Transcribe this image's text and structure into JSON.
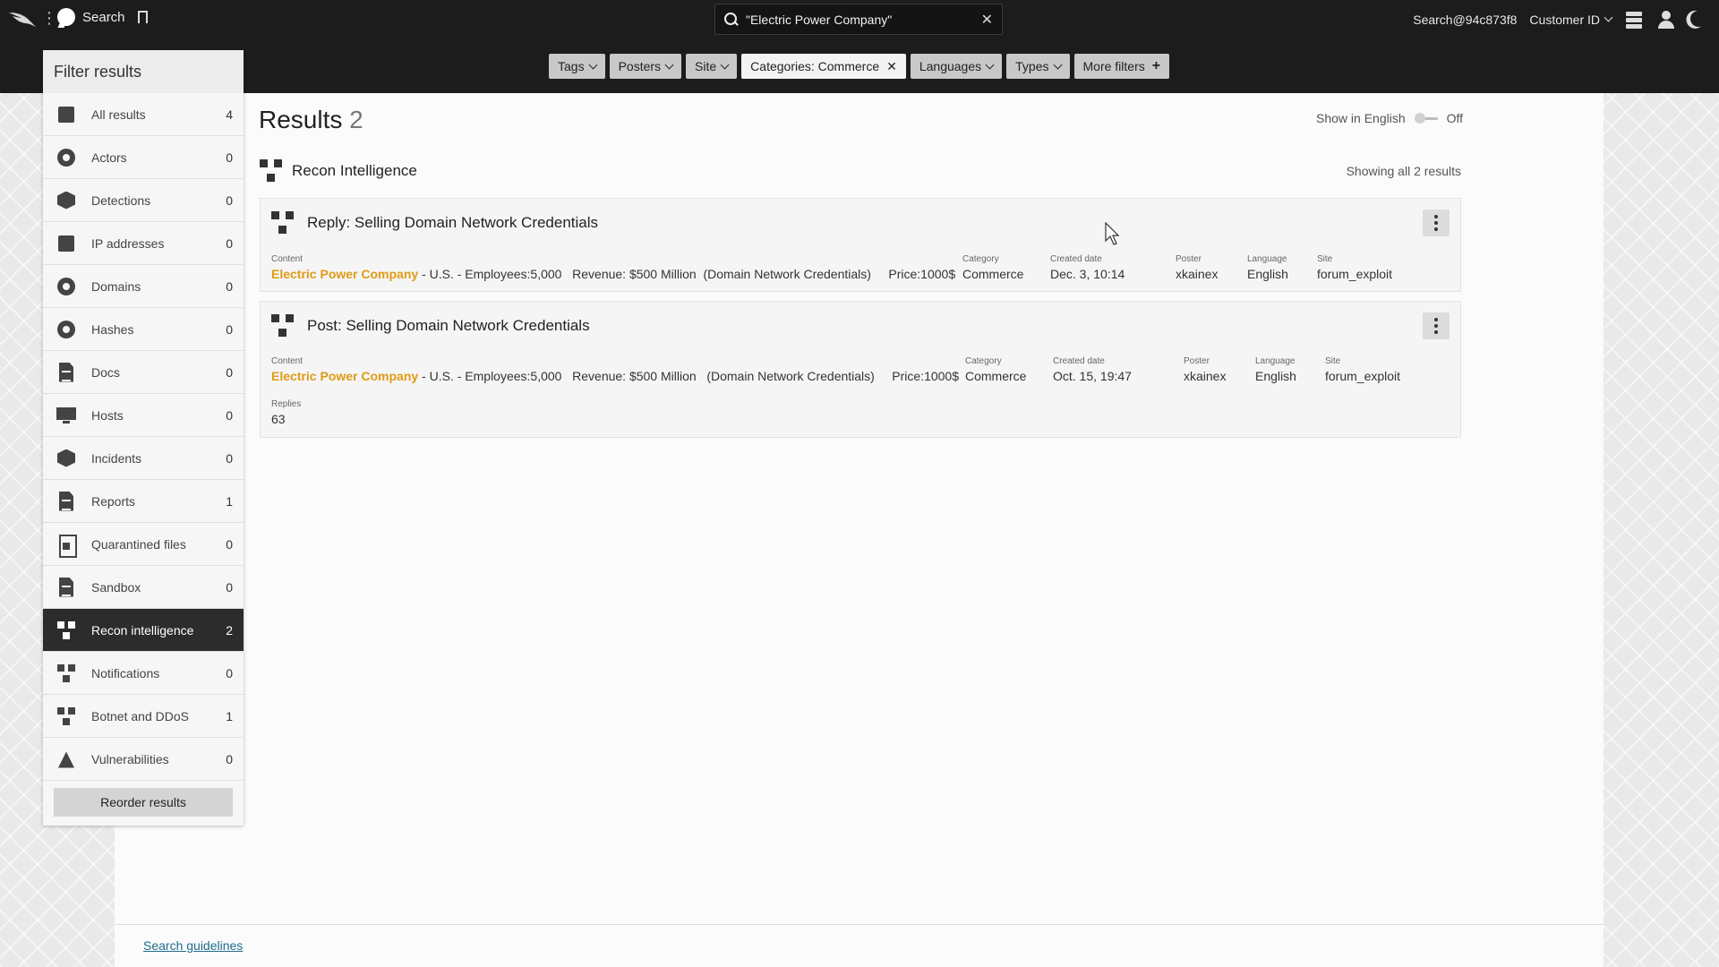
{
  "topbar": {
    "search_label": "Search",
    "search_query": "\"Electric Power Company\"",
    "account": "Search@94c873f8",
    "customer_label": "Customer ID"
  },
  "filters": [
    {
      "label": "Tags",
      "type": "dropdown"
    },
    {
      "label": "Posters",
      "type": "dropdown"
    },
    {
      "label": "Site",
      "type": "dropdown"
    },
    {
      "label": "Categories: Commerce",
      "type": "active"
    },
    {
      "label": "Languages",
      "type": "dropdown"
    },
    {
      "label": "Types",
      "type": "dropdown"
    },
    {
      "label": "More filters",
      "type": "add"
    }
  ],
  "sidebar": {
    "header": "Filter results",
    "items": [
      {
        "label": "All results",
        "count": "4",
        "icon": "all-results-icon"
      },
      {
        "label": "Actors",
        "count": "0",
        "icon": "actor-mask-icon"
      },
      {
        "label": "Detections",
        "count": "0",
        "icon": "detections-icon"
      },
      {
        "label": "IP addresses",
        "count": "0",
        "icon": "ip-address-icon"
      },
      {
        "label": "Domains",
        "count": "0",
        "icon": "globe-icon"
      },
      {
        "label": "Hashes",
        "count": "0",
        "icon": "fingerprint-icon"
      },
      {
        "label": "Docs",
        "count": "0",
        "icon": "document-icon"
      },
      {
        "label": "Hosts",
        "count": "0",
        "icon": "monitor-icon"
      },
      {
        "label": "Incidents",
        "count": "0",
        "icon": "hexagon-icon"
      },
      {
        "label": "Reports",
        "count": "1",
        "icon": "report-icon"
      },
      {
        "label": "Quarantined files",
        "count": "0",
        "icon": "locked-file-icon"
      },
      {
        "label": "Sandbox",
        "count": "0",
        "icon": "sandbox-icon"
      },
      {
        "label": "Recon intelligence",
        "count": "2",
        "icon": "recon-icon",
        "active": true
      },
      {
        "label": "Notifications",
        "count": "0",
        "icon": "recon-icon"
      },
      {
        "label": "Botnet and DDoS",
        "count": "1",
        "icon": "recon-icon"
      },
      {
        "label": "Vulnerabilities",
        "count": "0",
        "icon": "vulnerability-icon"
      }
    ],
    "reorder_label": "Reorder results"
  },
  "results": {
    "title": "Results",
    "count": "2",
    "show_english_label": "Show in English",
    "show_english_state": "Off",
    "section_title": "Recon Intelligence",
    "showing_text": "Showing all 2 results"
  },
  "cards": [
    {
      "title": "Reply: Selling Domain Network Credentials",
      "labels": {
        "content": "Content",
        "category": "Category",
        "created": "Created date",
        "poster": "Poster",
        "language": "Language",
        "site": "Site"
      },
      "content_highlight": "Electric Power Company",
      "content_rest": " - U.S. - Employees:5,000   Revenue: $500 Million  (Domain Network Credentials)     Price:1000$",
      "category": "Commerce",
      "created": "Dec. 3, 10:14",
      "poster": "xkainex",
      "language": "English",
      "site": "forum_exploit"
    },
    {
      "title": "Post: Selling Domain Network Credentials",
      "labels": {
        "content": "Content",
        "category": "Category",
        "created": "Created date",
        "poster": "Poster",
        "language": "Language",
        "site": "Site",
        "replies": "Replies"
      },
      "content_highlight": "Electric Power Company",
      "content_rest": " - U.S. - Employees:5,000   Revenue: $500 Million   (Domain Network Credentials)     Price:1000$",
      "category": "Commerce",
      "created": "Oct. 15, 19:47",
      "poster": "xkainex",
      "language": "English",
      "site": "forum_exploit",
      "replies": "63"
    }
  ],
  "footer": {
    "guidelines_link": "Search guidelines"
  },
  "colors": {
    "highlight": "#e09b15",
    "topbar": "#1c1c1c",
    "active_item": "#2c2c2c",
    "link": "#1f6b8a"
  }
}
